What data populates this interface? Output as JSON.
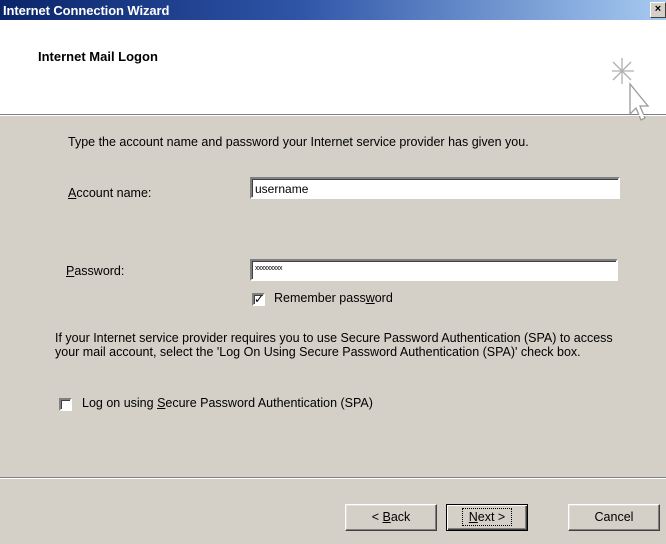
{
  "window": {
    "title": "Internet Connection Wizard",
    "close_label": "×"
  },
  "header": {
    "title": "Internet Mail Logon",
    "icon": "wizard-cursor-sparkle-icon"
  },
  "intro_text": "Type the account name and password your Internet service provider has given you.",
  "account": {
    "label_prefix": "",
    "label_key": "A",
    "label_rest": "ccount name:",
    "value": "username"
  },
  "password": {
    "label_key": "P",
    "label_rest": "assword:",
    "masked_value": "xxxxxxxxx"
  },
  "remember": {
    "label_before": "Remember pass",
    "label_key": "w",
    "label_after": "ord",
    "checked": true
  },
  "spa_info": "If your Internet service provider requires you to use Secure Password Authentication (SPA) to access your mail account, select the 'Log On Using Secure Password Authentication (SPA)' check box.",
  "spa": {
    "label_before": "Log on using ",
    "label_key": "S",
    "label_after": "ecure Password Authentication (SPA)",
    "checked": false
  },
  "buttons": {
    "back_prefix": "< ",
    "back_key": "B",
    "back_rest": "ack",
    "next_key": "N",
    "next_rest": "ext >",
    "cancel": "Cancel"
  }
}
